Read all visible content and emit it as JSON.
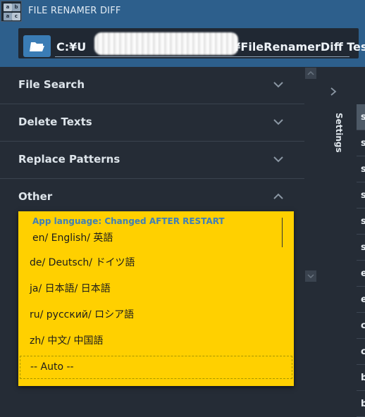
{
  "app": {
    "title": "FILE RENAMER DIFF"
  },
  "path_bar": {
    "path_prefix": "C:¥U",
    "path_suffix": "¥FileRenamerDiff Test"
  },
  "sections": [
    {
      "label": "File Search",
      "expanded": false
    },
    {
      "label": "Delete Texts",
      "expanded": false
    },
    {
      "label": "Replace Patterns",
      "expanded": false
    },
    {
      "label": "Other",
      "expanded": true
    }
  ],
  "language_dropdown": {
    "header": "App language: Changed AFTER RESTART",
    "selected": "en/ English/ 英語",
    "options": [
      "de/ Deutsch/ ドイツ語",
      "ja/ 日本語/ 日本語",
      "ru/ русский/ ロシア語",
      "zh/ 中文/ 中国語",
      "-- Auto --"
    ],
    "background": "#ffd000"
  },
  "side_tab": {
    "label": "Settings"
  },
  "right_list": {
    "items": [
      "s",
      "s",
      "s",
      "s",
      "s",
      "s",
      "e",
      "e",
      "c",
      "c",
      "b",
      "b"
    ]
  },
  "colors": {
    "titlebar": "#2d5f8c",
    "panel": "#252c36",
    "accent": "#3a7cb5"
  }
}
